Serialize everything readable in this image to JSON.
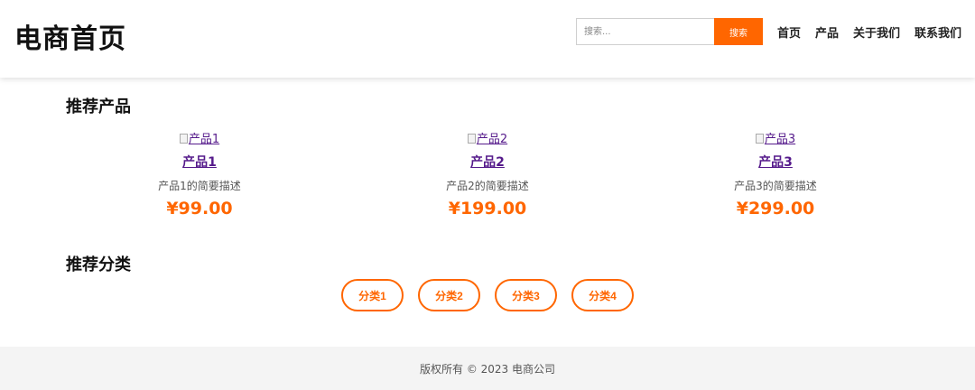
{
  "header": {
    "logo": "电商首页",
    "search": {
      "placeholder": "搜索...",
      "value": "",
      "button_label": "搜索"
    },
    "nav": [
      "首页",
      "产品",
      "关于我们",
      "联系我们"
    ]
  },
  "products_section": {
    "title": "推荐产品",
    "items": [
      {
        "img_alt": "产品1",
        "name": "产品1",
        "desc": "产品1的简要描述",
        "price": "¥99.00"
      },
      {
        "img_alt": "产品2",
        "name": "产品2",
        "desc": "产品2的简要描述",
        "price": "¥199.00"
      },
      {
        "img_alt": "产品3",
        "name": "产品3",
        "desc": "产品3的简要描述",
        "price": "¥299.00"
      }
    ]
  },
  "categories_section": {
    "title": "推荐分类",
    "items": [
      "分类1",
      "分类2",
      "分类3",
      "分类4"
    ]
  },
  "footer": {
    "copyright": "版权所有 © 2023 电商公司"
  },
  "colors": {
    "accent": "#ff6600",
    "link_visited": "#551a8b",
    "footer_bg": "#f4f4f4"
  }
}
